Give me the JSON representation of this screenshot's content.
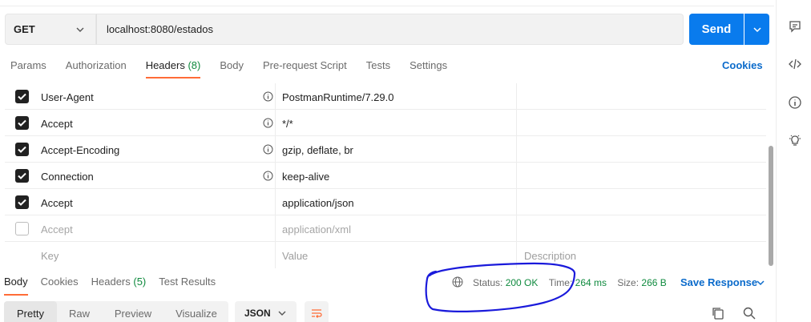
{
  "request": {
    "method": "GET",
    "url": "localhost:8080/estados",
    "send_label": "Send"
  },
  "tabs": [
    {
      "label": "Params"
    },
    {
      "label": "Authorization"
    },
    {
      "label": "Headers",
      "count": "(8)"
    },
    {
      "label": "Body"
    },
    {
      "label": "Pre-request Script"
    },
    {
      "label": "Tests"
    },
    {
      "label": "Settings"
    }
  ],
  "cookies_label": "Cookies",
  "headers": [
    {
      "key": "User-Agent",
      "value": "PostmanRuntime/7.29.0",
      "checked": true,
      "info": true
    },
    {
      "key": "Accept",
      "value": "*/*",
      "checked": true,
      "info": true
    },
    {
      "key": "Accept-Encoding",
      "value": "gzip, deflate, br",
      "checked": true,
      "info": true
    },
    {
      "key": "Connection",
      "value": "keep-alive",
      "checked": true,
      "info": true
    },
    {
      "key": "Accept",
      "value": "application/json",
      "checked": true,
      "info": false
    },
    {
      "key": "Accept",
      "value": "application/xml",
      "checked": false,
      "info": false
    }
  ],
  "placeholder_row": {
    "key": "Key",
    "value": "Value",
    "description": "Description"
  },
  "response": {
    "tabs": [
      {
        "label": "Body"
      },
      {
        "label": "Cookies"
      },
      {
        "label": "Headers",
        "count": "(5)"
      },
      {
        "label": "Test Results"
      }
    ],
    "status_label": "Status:",
    "status_value": "200 OK",
    "time_label": "Time:",
    "time_value": "264 ms",
    "size_label": "Size:",
    "size_value": "266 B",
    "save_label": "Save Response"
  },
  "view_modes": [
    "Pretty",
    "Raw",
    "Preview",
    "Visualize"
  ],
  "format": "JSON",
  "colors": {
    "accent": "#097bed",
    "active_tab": "#ff6c37",
    "success": "#0f8a3e",
    "annotation": "#1a1adb"
  }
}
